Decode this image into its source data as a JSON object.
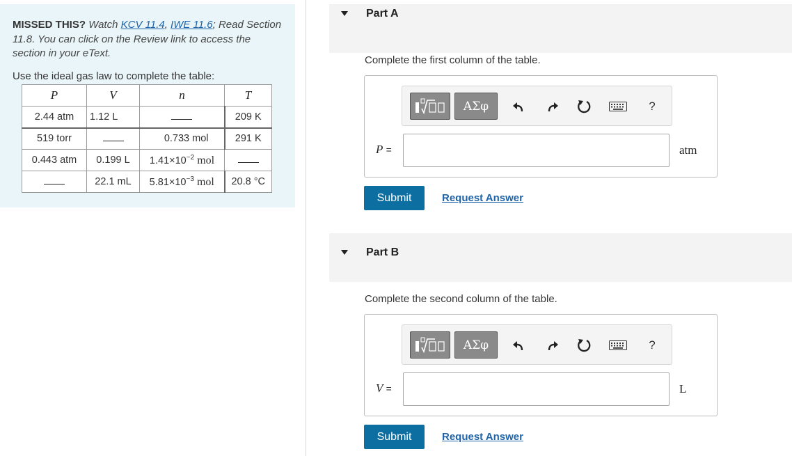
{
  "left": {
    "missed_label": "MISSED THIS?",
    "watch_text": "Watch",
    "link_kcv": "KCV 11.4",
    "comma": ",",
    "link_iwe": "IWE 11.6",
    "read_text": "; Read Section 11.8. You can click on the Review link to access the section in your eText.",
    "instruction": "Use the ideal gas law to complete the table:",
    "table": {
      "headers": [
        "P",
        "V",
        "n",
        "T"
      ],
      "rows": [
        {
          "P": "2.44 atm",
          "V": "1.12 L",
          "n": "",
          "T": "209 K"
        },
        {
          "P": "519 torr",
          "V": "",
          "n": "0.733 mol",
          "T": "291 K"
        },
        {
          "P": "0.443 atm",
          "V": "0.199 L",
          "n_base": "1.41×10",
          "n_exp": "−2",
          "n_unit": "mol",
          "T": ""
        },
        {
          "P": "",
          "V": "22.1 mL",
          "n_base": "5.81×10",
          "n_exp": "−3",
          "n_unit": "mol",
          "T": "20.8 °C"
        }
      ]
    }
  },
  "parts": [
    {
      "title": "Part A",
      "prompt": "Complete the first column of the table.",
      "variable": "P",
      "equals": "=",
      "unit": "atm",
      "submit": "Submit",
      "request": "Request Answer"
    },
    {
      "title": "Part B",
      "prompt": "Complete the second column of the table.",
      "variable": "V",
      "equals": "=",
      "unit": "L",
      "submit": "Submit",
      "request": "Request Answer"
    }
  ],
  "toolbar": {
    "greek_label": "ΑΣφ",
    "help_label": "?",
    "icons": [
      "templates-icon",
      "greek-symbols-icon",
      "undo-icon",
      "redo-icon",
      "reset-icon",
      "keyboard-icon",
      "help-icon"
    ]
  }
}
